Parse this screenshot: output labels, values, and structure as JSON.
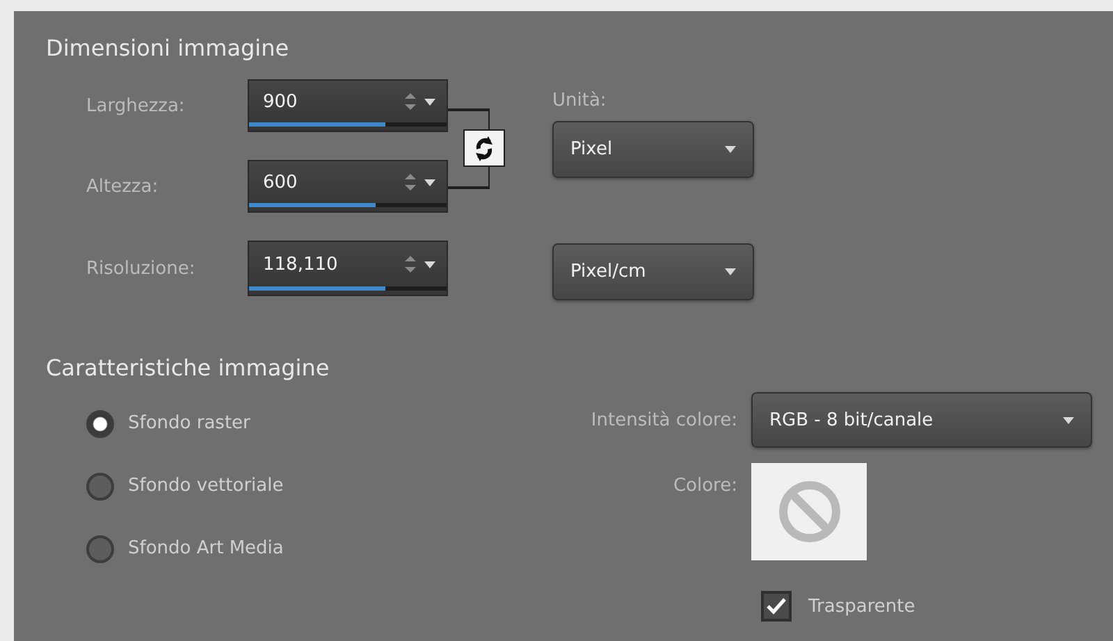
{
  "image_dimensions": {
    "title": "Dimensioni immagine",
    "fields": [
      {
        "label": "Larghezza:",
        "value": "900",
        "level": 0.69
      },
      {
        "label": "Altezza:",
        "value": "600",
        "level": 0.64
      },
      {
        "label": "Risoluzione:",
        "value": "118,110",
        "level": 0.69
      }
    ],
    "units": {
      "label": "Unità:",
      "value": "Pixel"
    },
    "resolution_units": {
      "value": "Pixel/cm"
    }
  },
  "image_characteristics": {
    "title": "Caratteristiche immagine",
    "backgrounds": [
      {
        "label": "Sfondo raster",
        "selected": true
      },
      {
        "label": "Sfondo vettoriale",
        "selected": false
      },
      {
        "label": "Sfondo Art Media",
        "selected": false
      }
    ],
    "color_depth": {
      "label": "Intensità colore:",
      "value": "RGB - 8 bit/canale"
    },
    "color": {
      "label": "Colore:"
    },
    "transparent": {
      "label": "Trasparente",
      "checked": true
    }
  }
}
